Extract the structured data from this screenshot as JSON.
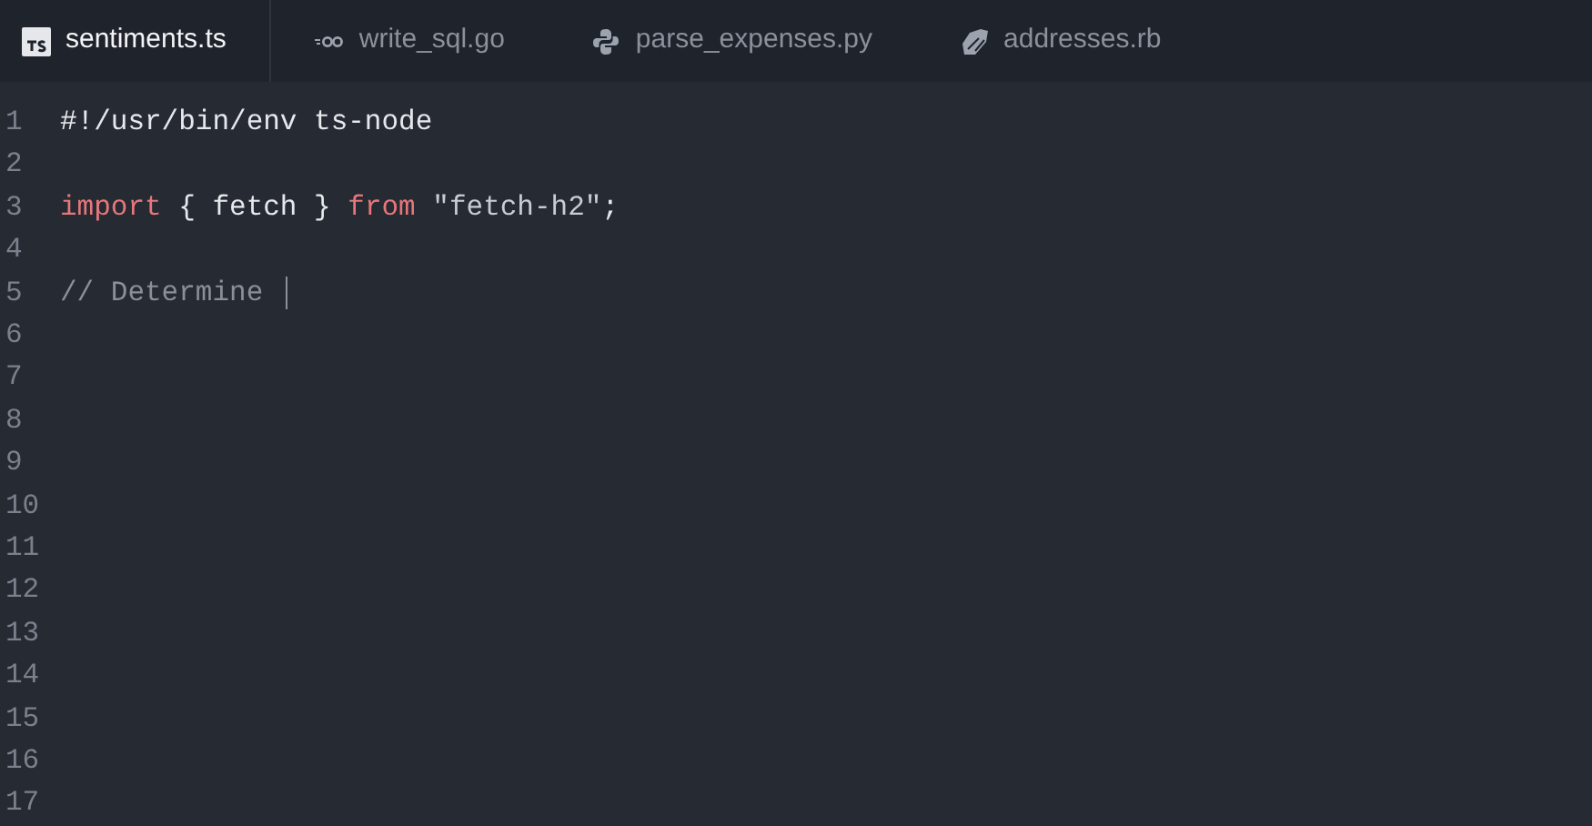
{
  "tabs": [
    {
      "label": "sentiments.ts",
      "kind": "ts",
      "selected": true
    },
    {
      "label": "write_sql.go",
      "kind": "go",
      "selected": false
    },
    {
      "label": "parse_expenses.py",
      "kind": "py",
      "selected": false
    },
    {
      "label": "addresses.rb",
      "kind": "rb",
      "selected": false
    }
  ],
  "lines": [
    {
      "number": "1",
      "cursor": false,
      "tokens": [
        {
          "kind": "plain",
          "text": "#!/usr/bin/env ts-node"
        }
      ]
    },
    {
      "number": "2",
      "cursor": false
    },
    {
      "number": "3",
      "cursor": false,
      "tokens": [
        {
          "kind": "keyword",
          "text": "import"
        },
        {
          "kind": "plain",
          "text": " { fetch } "
        },
        {
          "kind": "keyword",
          "text": "from"
        },
        {
          "kind": "string",
          "text": " \"fetch-h2\""
        },
        {
          "kind": "plain",
          "text": ";"
        }
      ]
    },
    {
      "number": "4",
      "cursor": false
    },
    {
      "number": "5",
      "cursor": true,
      "tokens": [
        {
          "kind": "comment",
          "text": "// Determine "
        }
      ]
    },
    {
      "number": "6",
      "cursor": false
    },
    {
      "number": "7",
      "cursor": false
    },
    {
      "number": "8",
      "cursor": false
    },
    {
      "number": "9",
      "cursor": false
    },
    {
      "number": "10",
      "cursor": false
    },
    {
      "number": "11",
      "cursor": false
    },
    {
      "number": "12",
      "cursor": false
    },
    {
      "number": "13",
      "cursor": false
    },
    {
      "number": "14",
      "cursor": false
    },
    {
      "number": "15",
      "cursor": false
    },
    {
      "number": "16",
      "cursor": false
    },
    {
      "number": "17",
      "cursor": false
    }
  ]
}
